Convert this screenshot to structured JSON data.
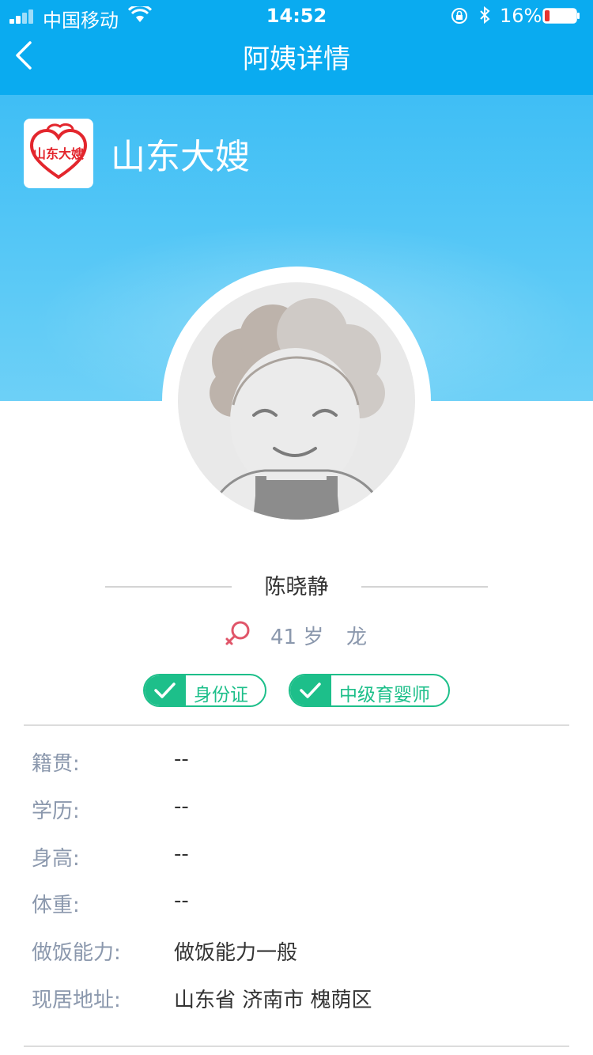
{
  "status_bar": {
    "carrier": "中国移动",
    "time": "14:52",
    "battery_percent": "16%",
    "battery_level": 0.16
  },
  "nav": {
    "title": "阿姨详情"
  },
  "brand": {
    "name": "山东大嫂",
    "logo_text": "山东大嫂"
  },
  "profile": {
    "name": "陈晓静",
    "gender_icon": "female-icon",
    "age": "41 岁",
    "zodiac": "龙"
  },
  "badges": [
    {
      "label": "身份证"
    },
    {
      "label": "中级育婴师"
    }
  ],
  "details": [
    {
      "label": "籍贯:",
      "value": "--"
    },
    {
      "label": "学历:",
      "value": "--"
    },
    {
      "label": "身高:",
      "value": "--"
    },
    {
      "label": "体重:",
      "value": "--"
    },
    {
      "label": "做饭能力:",
      "value": "做饭能力一般"
    },
    {
      "label": "现居地址:",
      "value": "山东省 济南市 槐荫区"
    }
  ],
  "colors": {
    "nav_bg": "#0aabf0",
    "accent_green": "#1dbf8a",
    "label_gray": "#8b98ad",
    "female_red": "#e05569"
  }
}
